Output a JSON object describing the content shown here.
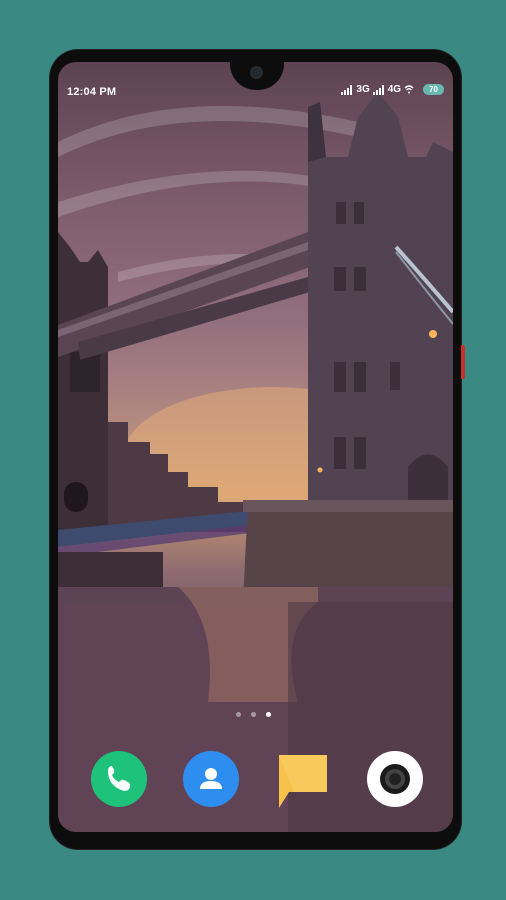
{
  "status_bar": {
    "time": "12:04 PM",
    "network_1": "3G",
    "network_2": "4G",
    "battery": "70"
  },
  "home_screen": {
    "page_count": 3,
    "active_page": 3,
    "dock": [
      {
        "name": "phone",
        "icon": "phone-icon",
        "color": "#1ec27a"
      },
      {
        "name": "contacts",
        "icon": "contacts-icon",
        "color": "#2d8ef0"
      },
      {
        "name": "messages",
        "icon": "message-icon",
        "color": "#f7c24a"
      },
      {
        "name": "camera",
        "icon": "camera-icon",
        "color": "#ffffff"
      }
    ]
  },
  "colors": {
    "background": "#3a8a83",
    "accent_battery": "#67b9b0",
    "phone_frame": "#0d0d0d"
  }
}
